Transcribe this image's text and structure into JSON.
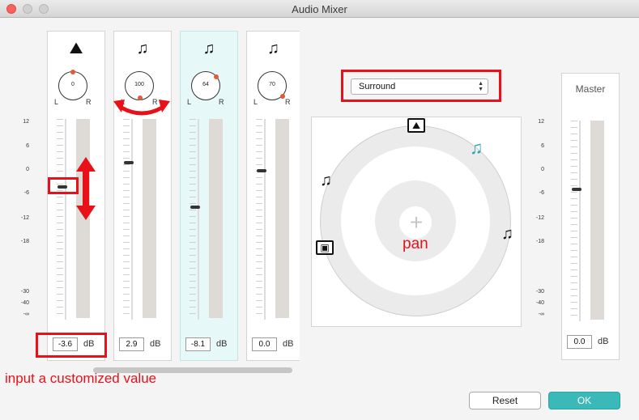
{
  "window": {
    "title": "Audio Mixer"
  },
  "scale_labels": [
    "12",
    "6",
    "0",
    "-6",
    "-12",
    "-18",
    "-30",
    "-40",
    "-∞"
  ],
  "channels": [
    {
      "icon": "image-icon",
      "glyph": "⛰",
      "pan": "0",
      "db": "-3.6",
      "selected": false
    },
    {
      "icon": "music-note-icon",
      "glyph": "♫",
      "pan": "100",
      "db": "2.9",
      "selected": false
    },
    {
      "icon": "music-note-icon",
      "glyph": "♫",
      "pan": "64",
      "db": "-8.1",
      "selected": true
    },
    {
      "icon": "music-note-icon",
      "glyph": "♫",
      "pan": "70",
      "db": "0.0",
      "selected": false
    }
  ],
  "knob_labels": {
    "left": "L",
    "right": "R"
  },
  "db_unit": "dB",
  "surround_select": {
    "value": "Surround"
  },
  "pan_label": "pan",
  "annotation_text": "input a customized value",
  "master": {
    "title": "Master",
    "db": "0.0"
  },
  "buttons": {
    "reset": "Reset",
    "ok": "OK"
  },
  "colors": {
    "annotation": "#e8111a",
    "accent": "#3bb9b9",
    "selected_channel": "#e6f8f7"
  }
}
